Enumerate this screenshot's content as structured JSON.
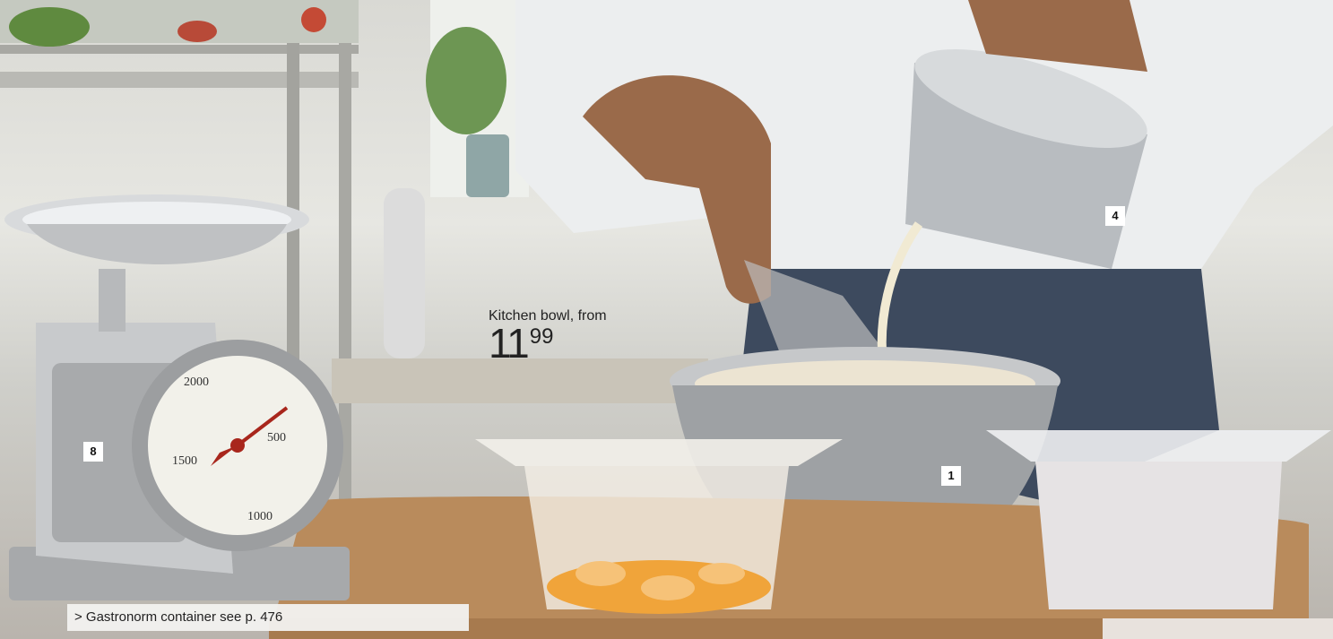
{
  "product": {
    "caption": "Kitchen bowl, from",
    "price_integer": "11",
    "price_decimal": "99"
  },
  "markers": {
    "scale": "8",
    "bowl": "1",
    "jug": "4"
  },
  "reference_note": "> Gastronorm container see p. 476",
  "scale_dial": {
    "labels": [
      "2000",
      "500",
      "1500",
      "1000"
    ]
  },
  "colors": {
    "marker_bg": "#ffffff",
    "note_bg": "#f2f2f0"
  }
}
